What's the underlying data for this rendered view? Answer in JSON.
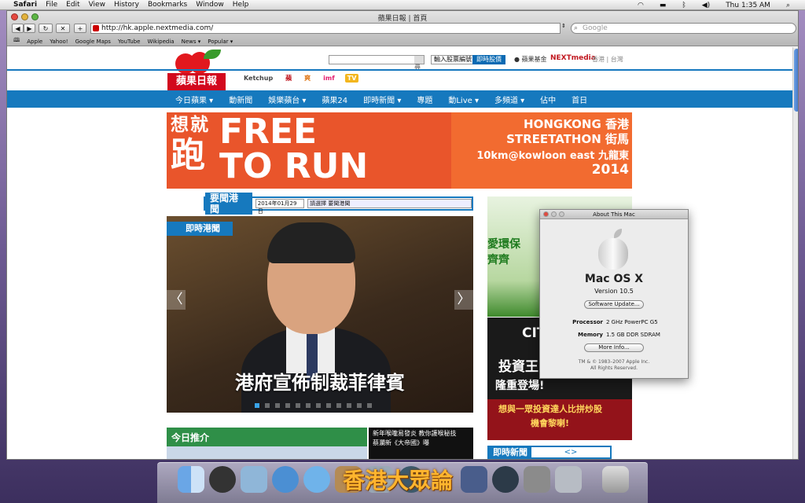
{
  "menubar": {
    "apple": "",
    "app": "Safari",
    "items": [
      "File",
      "Edit",
      "View",
      "History",
      "Bookmarks",
      "Window",
      "Help"
    ],
    "clock": "Thu 1:35 AM"
  },
  "browser": {
    "title": "蘋果日報 | 首頁",
    "url": "http://hk.apple.nextmedia.com/",
    "search_placeholder": "Google",
    "bookmarks": [
      "Apple",
      "Yahoo!",
      "Google Maps",
      "YouTube",
      "Wikipedia",
      "News ▾",
      "Popular ▾"
    ]
  },
  "site": {
    "logo": "蘋果日報",
    "search_placeholder": "搜尋",
    "stock_label": "輸入股票編號",
    "realtime_label": "即時股價",
    "fund_label": "● 蘋果基金",
    "nextmedia": "NEXTmedia",
    "regions": "香港 | 台灣",
    "products": [
      "Ketchup",
      "蘋",
      "爽",
      "imf",
      "TV"
    ],
    "nav": [
      "今日蘋果 ▾",
      "動新聞",
      "娛樂蘋台 ▾",
      "蘋果24",
      "即時新聞 ▾",
      "專題",
      "動Live ▾",
      "多頻道 ▾",
      "佔中",
      "首日"
    ],
    "banner": {
      "l1": "想就",
      "l2": "跑",
      "free": "FREE",
      "torun": "TO RUN",
      "r1": "HONGKONG 香港",
      "r2": "STREETATHON 街馬",
      "r3": "10km@kowloon east 九龍東",
      "r4": "2014"
    },
    "date_bar": {
      "title": "要聞港聞",
      "date": "2014年01月29日",
      "select": "請選擇 要聞港聞"
    },
    "hero": {
      "tag": "即時港聞",
      "caption": "港府宣佈制裁菲律賓",
      "prev": "〈",
      "next": "〉"
    },
    "today": "今日推介",
    "news": [
      "新年喉嚨易發炎 教你護喉秘技",
      "蔡瀾新《大帝國》曝"
    ],
    "ad1": [
      "愛環保",
      "齊齊"
    ],
    "ad2": [
      "CITI",
      "投資王",
      "隆重登場!",
      "想與一眾投資達人比拼炒股",
      "機會黎喇!"
    ],
    "latest": "即時新聞"
  },
  "about": {
    "title": "About This Mac",
    "os": "Mac OS X",
    "version": "Version 10.5",
    "update_btn": "Software Update...",
    "processor_label": "Processor",
    "processor": "2 GHz PowerPC G5",
    "memory_label": "Memory",
    "memory": "1.5 GB DDR SDRAM",
    "more_btn": "More Info...",
    "foot1": "TM & © 1983–2007 Apple Inc.",
    "foot2": "All Rights Reserved."
  },
  "watermark": "香港大眾論"
}
